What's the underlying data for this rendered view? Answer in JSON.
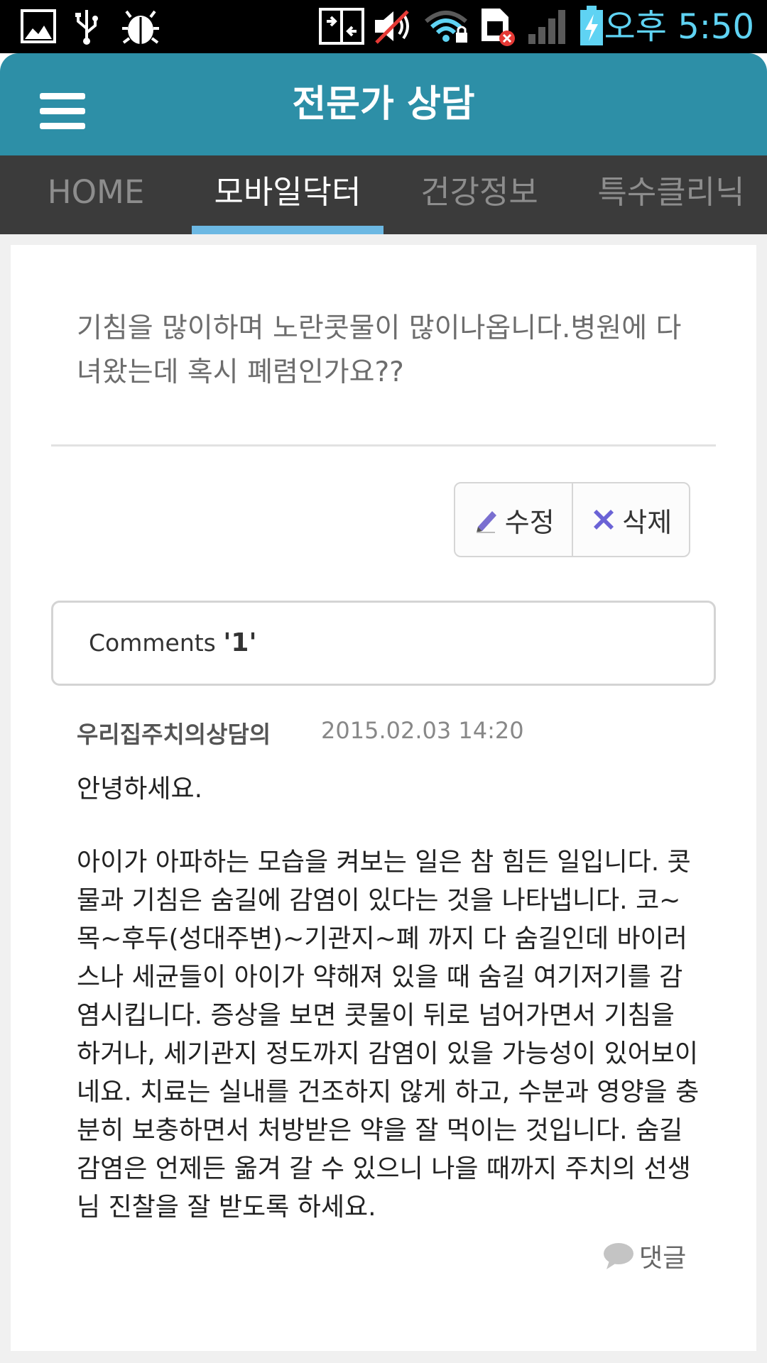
{
  "status_bar": {
    "icons": [
      "image-icon",
      "usb-icon",
      "bug-icon",
      "data-transfer-icon",
      "volume-muted-icon",
      "wifi-lock-icon",
      "sim-error-icon",
      "signal-icon",
      "battery-charging-icon"
    ],
    "time": "오후 5:50",
    "accent_color": "#5fd3f3"
  },
  "header": {
    "title": "전문가 상담",
    "menu_icon": "hamburger-menu-icon",
    "color": "#2d8fa7"
  },
  "tabs": {
    "items": [
      {
        "label": "HOME",
        "active": false
      },
      {
        "label": "모바일닥터",
        "active": true
      },
      {
        "label": "건강정보",
        "active": false
      },
      {
        "label": "특수클리닉",
        "active": false
      }
    ],
    "indicator_color": "#6cb8e3"
  },
  "question": {
    "text": "기침을 많이하며 노란콧물이 많이나옵니다.병원에 다녀왔는데 혹시 폐렴인가요??"
  },
  "actions": {
    "edit_label": "수정",
    "edit_icon": "pencil-icon",
    "delete_label": "삭제",
    "delete_icon": "x-icon"
  },
  "comments": {
    "label": "Comments",
    "count": "'1'",
    "items": [
      {
        "author": "우리집주치의상담의",
        "date": "2015.02.03 14:20",
        "greeting": "안녕하세요.",
        "body": "아이가 아파하는 모습을 켜보는 일은 참 힘든 일입니다. 콧물과 기침은 숨길에 감염이 있다는 것을 나타냅니다. 코~목~후두(성대주변)~기관지~폐 까지 다 숨길인데 바이러스나 세균들이 아이가 약해져 있을 때 숨길 여기저기를 감염시킵니다. 증상을 보면 콧물이 뒤로 넘어가면서 기침을 하거나, 세기관지 정도까지 감염이 있을 가능성이 있어보이네요. 치료는 실내를 건조하지 않게 하고, 수분과 영양을 충분히 보충하면서 처방받은 약을 잘 먹이는 것입니다. 숨길 감염은 언제든 옮겨 갈 수 있으니 나을 때까지 주치의 선생님 진찰을 잘 받도록 하세요."
      }
    ],
    "reply_label": "댓글",
    "reply_icon": "speech-bubble-icon"
  }
}
